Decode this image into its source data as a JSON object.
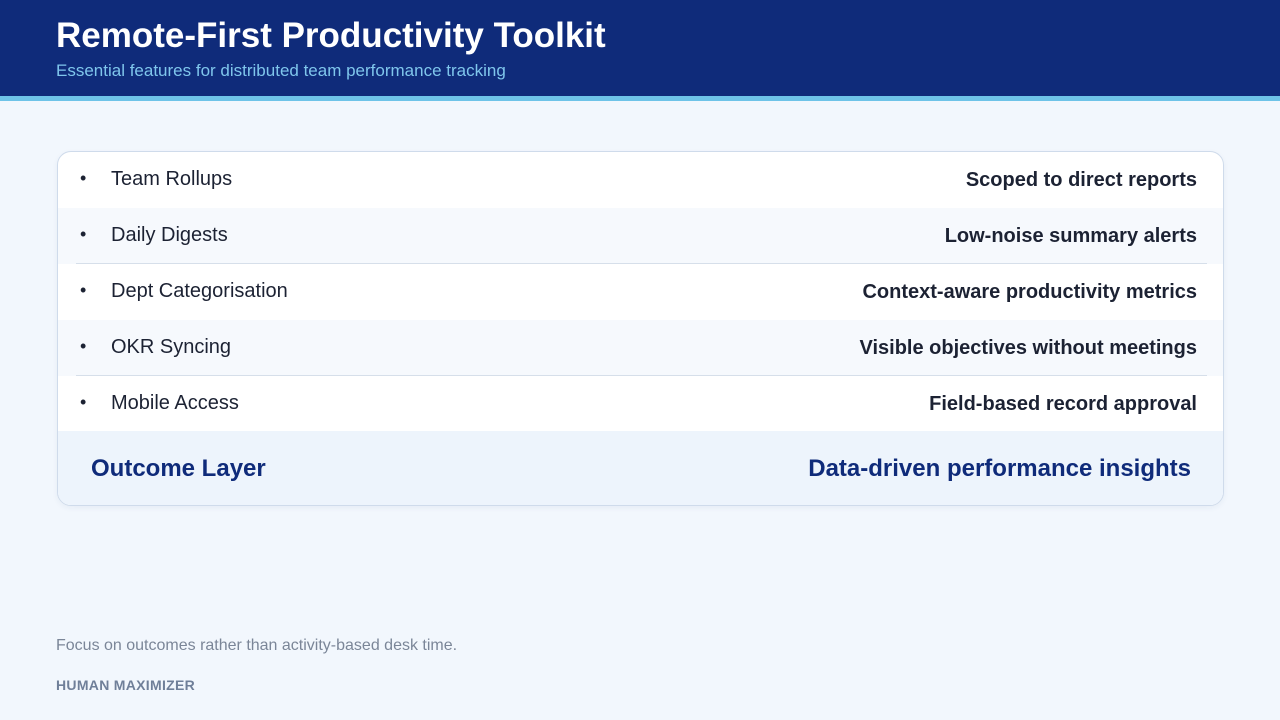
{
  "header": {
    "title": "Remote-First Productivity Toolkit",
    "subtitle": "Essential features for distributed team performance tracking"
  },
  "features": [
    {
      "bullet": "•",
      "name": "Team Rollups",
      "benefit": "Scoped to direct reports"
    },
    {
      "bullet": "•",
      "name": "Daily Digests",
      "benefit": "Low-noise summary alerts"
    },
    {
      "bullet": "•",
      "name": "Dept Categorisation",
      "benefit": "Context-aware productivity metrics"
    },
    {
      "bullet": "•",
      "name": "OKR Syncing",
      "benefit": "Visible objectives without meetings"
    },
    {
      "bullet": "•",
      "name": "Mobile Access",
      "benefit": "Field-based record approval"
    }
  ],
  "outcome": {
    "label": "Outcome Layer",
    "value": "Data-driven performance insights"
  },
  "footer": {
    "note": "Focus on outcomes rather than activity-based desk time.",
    "brand": "HUMAN MAXIMIZER"
  },
  "colors": {
    "header_bg": "#0f2b7a",
    "accent": "#6ec3e8",
    "page_bg": "#f2f7fd"
  }
}
